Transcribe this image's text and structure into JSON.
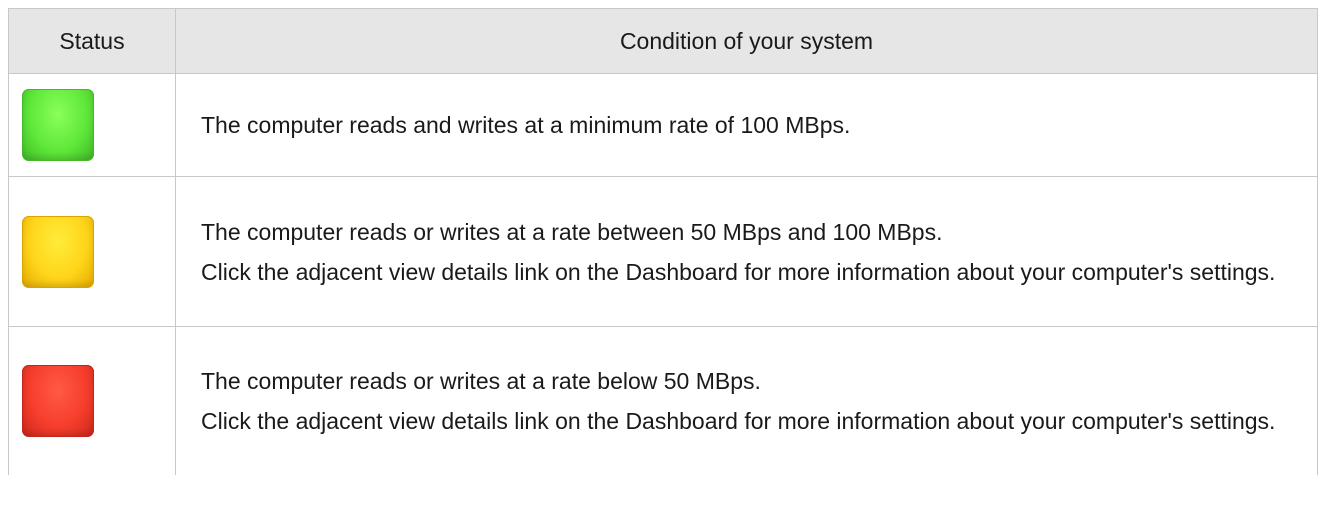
{
  "table": {
    "headers": {
      "status": "Status",
      "condition": "Condition of your system"
    },
    "rows": [
      {
        "status_color": "#5fe83a",
        "lines": [
          "The computer reads and writes at a minimum rate of 100 MBps."
        ]
      },
      {
        "status_color": "#ffd51a",
        "lines": [
          "The computer reads or writes at a rate between 50 MBps and 100 MBps.",
          "Click the adjacent view details link on the Dashboard for more information about your computer's settings."
        ]
      },
      {
        "status_color": "#f63e2c",
        "lines": [
          "The computer reads or writes at a rate below 50 MBps.",
          "Click the adjacent view details link on the Dashboard for more information about your computer's settings."
        ]
      }
    ]
  }
}
